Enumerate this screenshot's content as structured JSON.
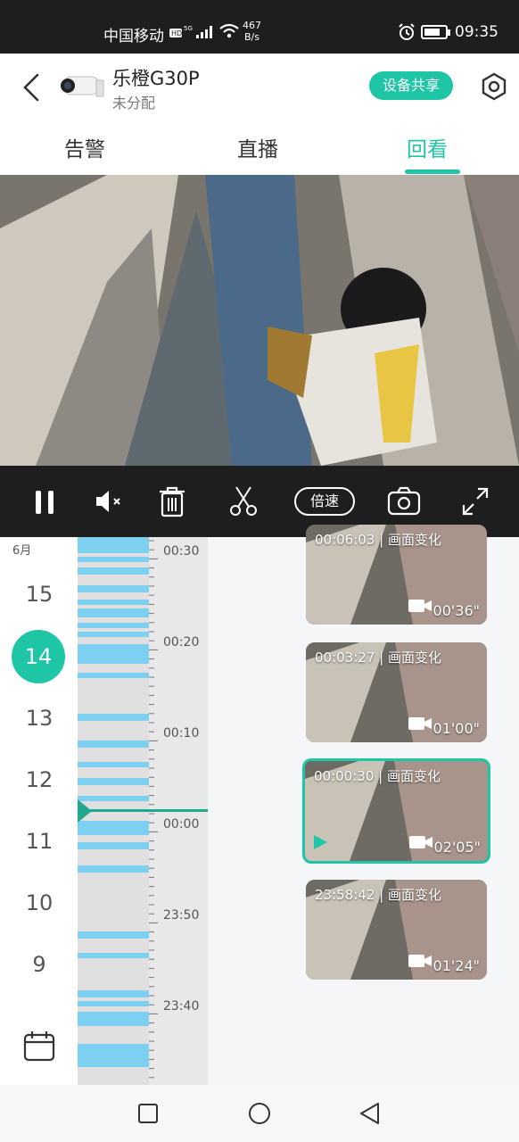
{
  "status_bar": {
    "carrier": "中国移动",
    "network": "HD 5G",
    "speed_value": "467",
    "speed_unit": "B/s",
    "time": "09:35",
    "battery_percent": 75
  },
  "header": {
    "device_name": "乐橙G30P",
    "device_subtitle": "未分配",
    "share_label": "设备共享"
  },
  "tabs": [
    {
      "label": "告警"
    },
    {
      "label": "直播"
    },
    {
      "label": "回看",
      "active": true
    }
  ],
  "controls": {
    "speed_label": "倍速"
  },
  "dates": {
    "month": "6月",
    "days": [
      "15",
      "14",
      "13",
      "12",
      "11",
      "10",
      "9"
    ],
    "active_day": "14"
  },
  "timeline": {
    "labels": [
      "00:30",
      "00:20",
      "00:10",
      "00:00",
      "23:50",
      "23:40"
    ]
  },
  "clips": [
    {
      "time": "00:06:03",
      "type": "画面变化",
      "duration": "00'36\""
    },
    {
      "time": "00:03:27",
      "type": "画面变化",
      "duration": "01'00\""
    },
    {
      "time": "00:00:30",
      "type": "画面变化",
      "duration": "02'05\"",
      "active": true
    },
    {
      "time": "23:58:42",
      "type": "画面变化",
      "duration": "01'24\""
    }
  ],
  "colors": {
    "accent": "#1fc6a6",
    "timeline_segment": "#7dd0f0",
    "dark_bar": "#1e1e1e"
  }
}
